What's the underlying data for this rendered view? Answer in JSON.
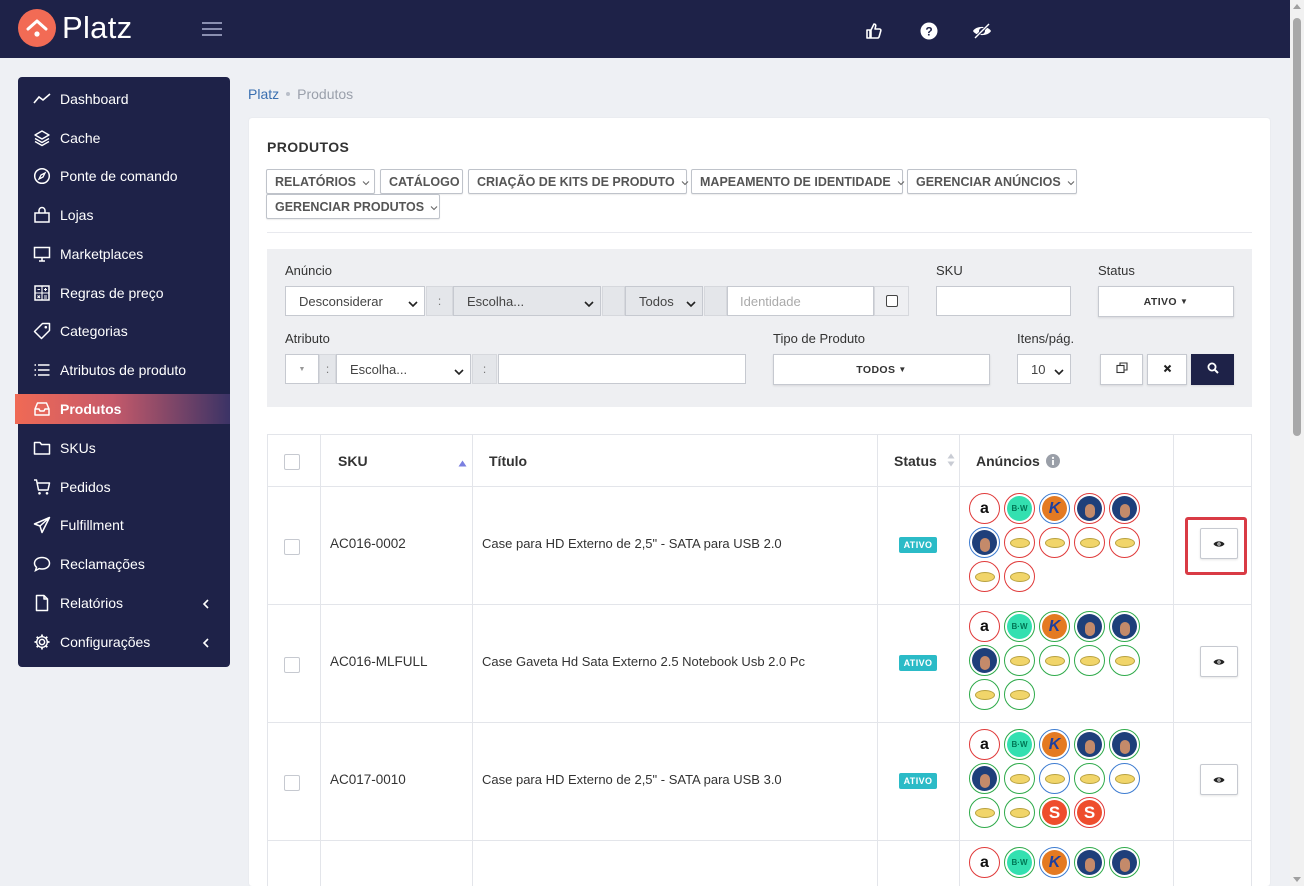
{
  "app": {
    "name": "Platz"
  },
  "sidebar": {
    "items": [
      {
        "label": "Dashboard",
        "icon": "trend-line-icon"
      },
      {
        "label": "Cache",
        "icon": "layers-icon"
      },
      {
        "label": "Ponte de comando",
        "icon": "compass-icon"
      },
      {
        "label": "Lojas",
        "icon": "shopping-bag-icon"
      },
      {
        "label": "Marketplaces",
        "icon": "monitor-icon"
      },
      {
        "label": "Regras de preço",
        "icon": "calculator-icon"
      },
      {
        "label": "Categorias",
        "icon": "tag-icon"
      },
      {
        "label": "Atributos de produto",
        "icon": "list-icon"
      },
      {
        "label": "Produtos",
        "icon": "inbox-icon",
        "active": true
      },
      {
        "label": "SKUs",
        "icon": "folder-icon"
      },
      {
        "label": "Pedidos",
        "icon": "cart-icon"
      },
      {
        "label": "Fulfillment",
        "icon": "plane-icon"
      },
      {
        "label": "Reclamações",
        "icon": "chat-bubble-icon"
      },
      {
        "label": "Relatórios",
        "icon": "document-icon",
        "expandable": true
      },
      {
        "label": "Configurações",
        "icon": "gear-icon",
        "expandable": true
      }
    ]
  },
  "breadcrumb": {
    "root": "Platz",
    "current": "Produtos"
  },
  "page": {
    "title": "PRODUTOS",
    "toolbar": [
      "RELATÓRIOS",
      "CATÁLOGO",
      "CRIAÇÃO DE KITS DE PRODUTO",
      "MAPEAMENTO DE IDENTIDADE",
      "GERENCIAR ANÚNCIOS",
      "GERENCIAR PRODUTOS"
    ]
  },
  "filters": {
    "anuncio_label": "Anúncio",
    "anuncio_mode": "Desconsiderar",
    "anuncio_choice": "Escolha...",
    "anuncio_scope": "Todos",
    "identidade_placeholder": "Identidade",
    "sku_label": "SKU",
    "status_label": "Status",
    "status_value": "ATIVO",
    "atributo_label": "Atributo",
    "atributo_choice": "Escolha...",
    "tipo_label": "Tipo de Produto",
    "tipo_value": "TODOS",
    "itens_label": "Itens/pág.",
    "itens_value": "10",
    "separator": ":"
  },
  "table": {
    "headers": {
      "sku": "SKU",
      "titulo": "Título",
      "status": "Status",
      "anuncios": "Anúncios"
    },
    "rows": [
      {
        "sku": "AC016-0002",
        "titulo": "Case para HD Externo de 2,5\" - SATA para USB 2.0",
        "status": "ATIVO",
        "anuncios": [
          "amazon-r",
          "bw-r",
          "k-b",
          "avatar-r",
          "avatar-r",
          "avatar-r",
          "bowl-r",
          "bowl-r",
          "bowl-r",
          "bowl-r",
          "bowl-r",
          "bowl-r"
        ]
      },
      {
        "sku": "AC016-MLFULL",
        "titulo": "Case Gaveta Hd Sata Externo 2.5 Notebook Usb 2.0 Pc",
        "status": "ATIVO",
        "anuncios": [
          "amazon-r",
          "bw-g",
          "k-g",
          "avatar-g",
          "avatar-g",
          "avatar-g",
          "bowl-g",
          "bowl-g",
          "bowl-g",
          "bowl-g",
          "bowl-g",
          "bowl-g"
        ]
      },
      {
        "sku": "AC017-0010",
        "titulo": "Case para HD Externo de 2,5\" - SATA para USB 3.0",
        "status": "ATIVO",
        "anuncios": [
          "amazon-r",
          "bw-g",
          "k-b",
          "avatar-g",
          "avatar-g",
          "avatar-g",
          "bowl-g",
          "bowl-b",
          "bowl-g",
          "bowl-b",
          "bowl-g",
          "bowl-g",
          "shopee-g",
          "shopee-r"
        ]
      },
      {
        "sku": "",
        "titulo": "",
        "status": "",
        "anuncios": [
          "amazon-r",
          "bw-g",
          "k-b",
          "avatar-g",
          "avatar-g"
        ]
      }
    ]
  },
  "colors": {
    "navy": "#1e2248",
    "accent": "#f26b55",
    "badge": "#2bbbc7",
    "highlight": "#d93b45"
  }
}
